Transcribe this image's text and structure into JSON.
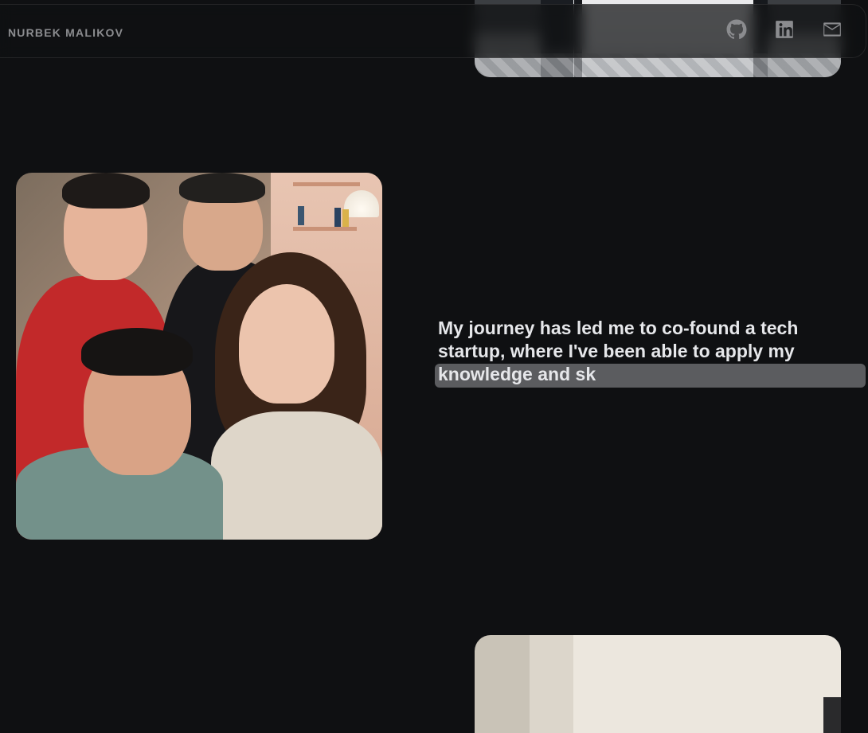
{
  "header": {
    "brand": "NURBEK MALIKOV",
    "links": [
      {
        "name": "github",
        "icon": "github-icon"
      },
      {
        "name": "linkedin",
        "icon": "linkedin-icon"
      },
      {
        "name": "email",
        "icon": "mail-icon"
      }
    ]
  },
  "story": {
    "lines": [
      "My journey has led me to co-found a tech",
      "startup, where I've been able to apply my",
      "knowledge and sk"
    ]
  },
  "colors": {
    "background": "#0f1012",
    "text": "#e6e7ea",
    "muted": "#8b8c8f",
    "highlight": "#5b5c5f"
  }
}
